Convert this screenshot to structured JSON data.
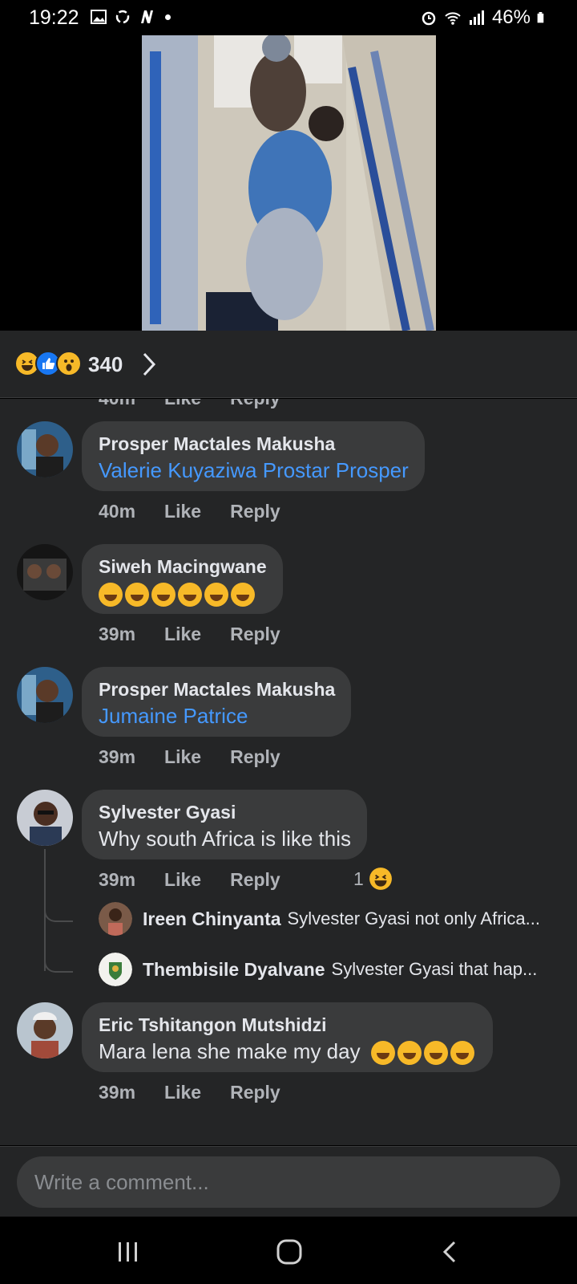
{
  "status_bar": {
    "time": "19:22",
    "battery": "46%"
  },
  "reactions": {
    "icons": [
      "haha",
      "like",
      "wow"
    ],
    "count": "340"
  },
  "partial_previous": {
    "time": "40m",
    "like": "Like",
    "reply": "Reply"
  },
  "comments": [
    {
      "name": "Prosper Mactales Makusha",
      "text": "Valerie Kuyaziwa Prostar Prosper",
      "is_tag": true,
      "time": "40m",
      "like": "Like",
      "reply": "Reply"
    },
    {
      "name": "Siweh Macingwane",
      "emoji_count": 6,
      "time": "39m",
      "like": "Like",
      "reply": "Reply"
    },
    {
      "name": "Prosper Mactales Makusha",
      "text": "Jumaine Patrice",
      "is_tag": true,
      "time": "39m",
      "like": "Like",
      "reply": "Reply"
    },
    {
      "name": "Sylvester Gyasi",
      "text": "Why south Africa is like this",
      "time": "39m",
      "like": "Like",
      "reply": "Reply",
      "reaction_count": "1",
      "replies": [
        {
          "name": "Ireen Chinyanta",
          "text": "Sylvester Gyasi not only Africa..."
        },
        {
          "name": "Thembisile Dyalvane",
          "text": "Sylvester Gyasi that hap..."
        }
      ]
    },
    {
      "name": "Eric Tshitangon Mutshidzi",
      "text": "Mara lena she make my day",
      "emoji_count": 4,
      "time": "39m",
      "like": "Like",
      "reply": "Reply"
    }
  ],
  "composer": {
    "placeholder": "Write a comment..."
  },
  "colors": {
    "panel": "#242526",
    "bubble": "#3a3b3c",
    "tag_link": "#4599ff",
    "meta": "#b0b3b8"
  }
}
